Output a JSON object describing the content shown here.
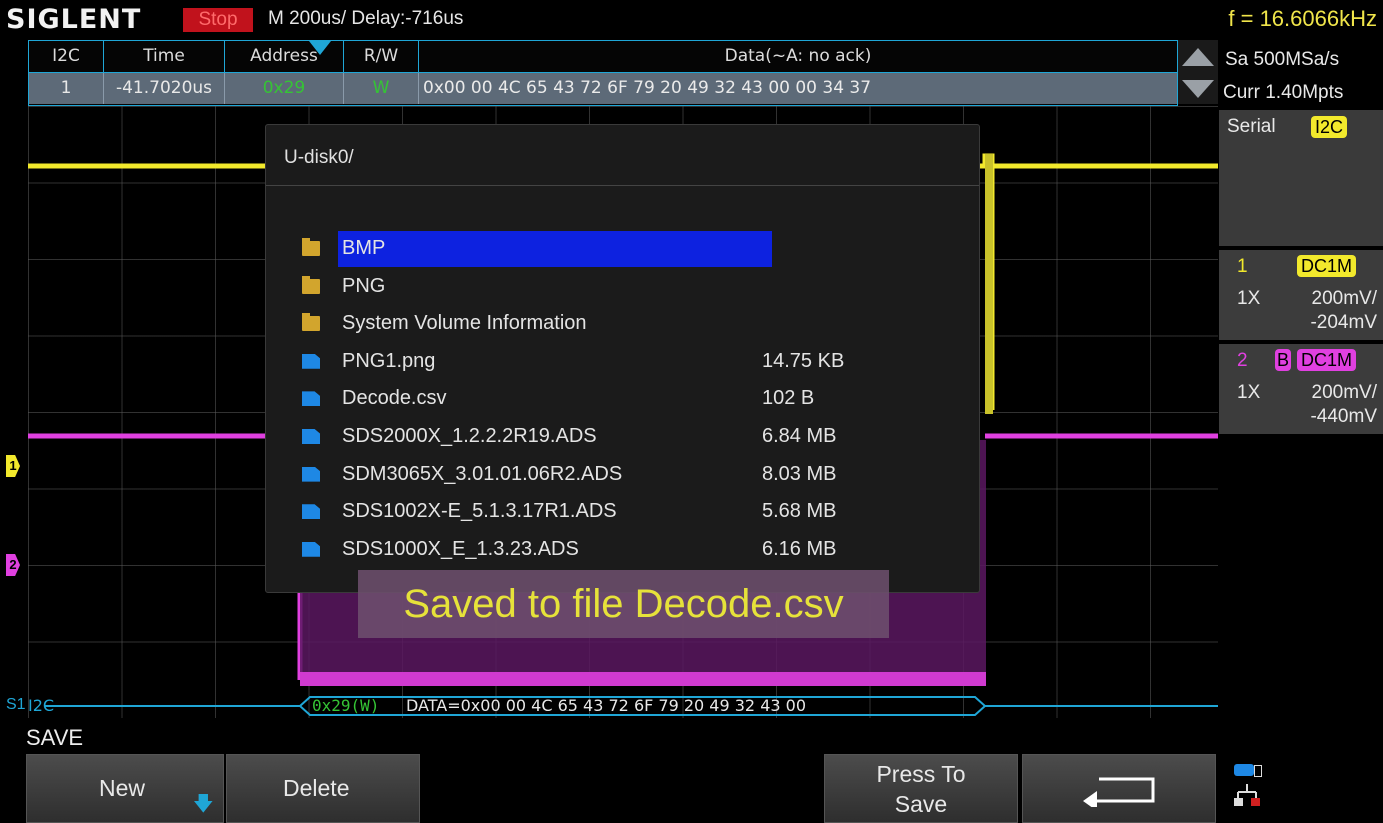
{
  "brand": "SIGLENT",
  "status": "Stop",
  "timebase": "M 200us/   Delay:-716us",
  "frequency": "f = 16.6066kHz",
  "decode_table": {
    "headers": [
      "I2C",
      "Time",
      "Address",
      "R/W",
      "Data(~A: no ack)"
    ],
    "row": [
      "1",
      "-41.7020us",
      "0x29",
      "W",
      "0x00 00 4C 65 43 72 6F 79 20 49 32 43 00 00 34 37"
    ]
  },
  "right_panel": {
    "sample_rate": "Sa 500MSa/s",
    "curr": "Curr 1.40Mpts",
    "serial_label": "Serial",
    "serial_badge": "I2C",
    "ch1": {
      "num": "1",
      "coupling": "DC1M",
      "probe": "1X",
      "scale": "200mV/",
      "offset": "-204mV"
    },
    "ch2": {
      "num": "2",
      "bw": "B",
      "coupling": "DC1M",
      "probe": "1X",
      "scale": "200mV/",
      "offset": "-440mV"
    }
  },
  "dialog": {
    "path": "U-disk0/",
    "items": [
      {
        "type": "folder",
        "name": "BMP",
        "size": ""
      },
      {
        "type": "folder",
        "name": "PNG",
        "size": ""
      },
      {
        "type": "folder",
        "name": "System Volume Information",
        "size": ""
      },
      {
        "type": "file",
        "name": "PNG1.png",
        "size": "14.75 KB"
      },
      {
        "type": "file",
        "name": "Decode.csv",
        "size": "102 B"
      },
      {
        "type": "file",
        "name": "SDS2000X_1.2.2.2R19.ADS",
        "size": "6.84 MB"
      },
      {
        "type": "file",
        "name": "SDM3065X_3.01.01.06R2.ADS",
        "size": "8.03 MB"
      },
      {
        "type": "file",
        "name": "SDS1002X-E_5.1.3.17R1.ADS",
        "size": "5.68 MB"
      },
      {
        "type": "file",
        "name": "SDS1000X_E_1.3.23.ADS",
        "size": "6.16 MB"
      }
    ]
  },
  "toast": "Saved to file Decode.csv",
  "bus_label": "I2C",
  "bus_channel": "S1",
  "bus_addr": "0x29(W)",
  "bus_data": "DATA=0x00 00 4C 65 43 72 6F 79 20 49 32 43 00",
  "menu_title": "SAVE",
  "softkeys": {
    "new": "New",
    "delete": "Delete",
    "press_line1": "Press To",
    "press_line2": "Save"
  },
  "markers": {
    "ch1": "1",
    "ch2": "2"
  },
  "colors": {
    "ch1": "#f2e92c",
    "ch2": "#e040e0",
    "accent": "#1fa6d6",
    "address": "#35c435",
    "selected": "#0d22e0"
  }
}
